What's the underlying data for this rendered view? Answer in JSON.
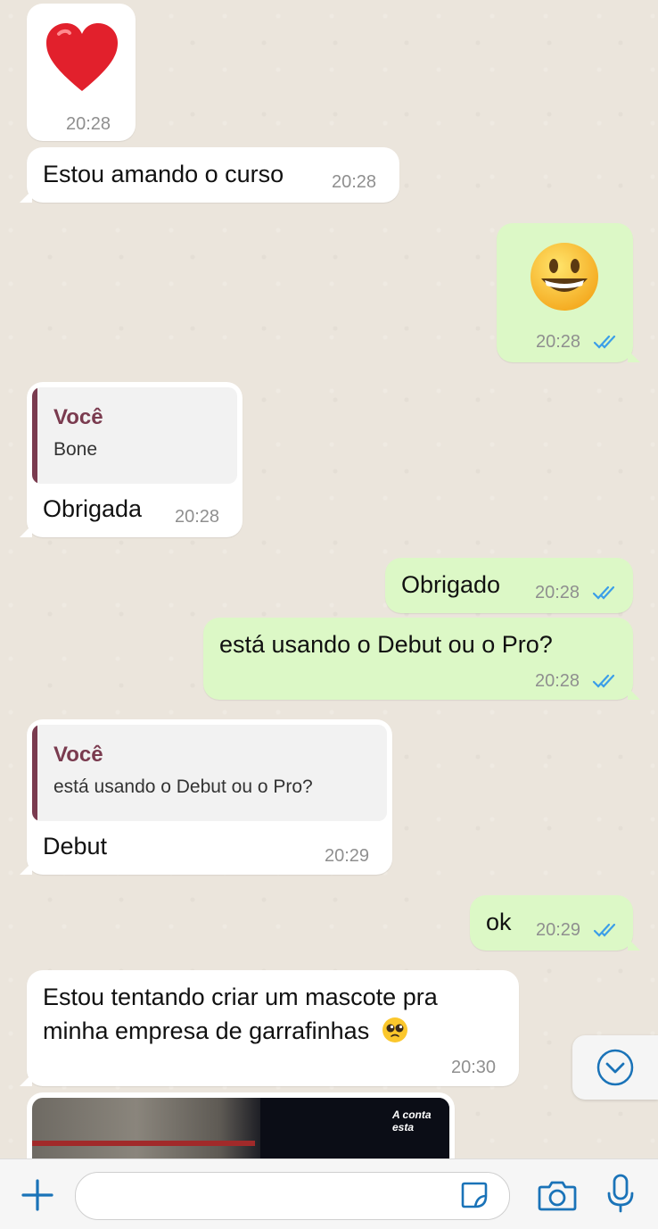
{
  "messages": [
    {
      "emoji_name": "red-heart",
      "time": "20:28"
    },
    {
      "text": "Estou amando o curso",
      "time": "20:28"
    },
    {
      "emoji_name": "grinning-face",
      "time": "20:28"
    },
    {
      "quote_author": "Você",
      "quote_text": "Bone",
      "text": "Obrigada",
      "time": "20:28"
    },
    {
      "text": "Obrigado",
      "time": "20:28"
    },
    {
      "text": "está usando o Debut ou o Pro?",
      "time": "20:28"
    },
    {
      "quote_author": "Você",
      "quote_text": "está usando o Debut ou o Pro?",
      "text": "Debut",
      "time": "20:29"
    },
    {
      "text": "ok",
      "time": "20:29"
    },
    {
      "text_line1": "Estou tentando criar um mascote pra",
      "text_line2": "minha empresa de garrafinhas",
      "emoji_name": "pleading-face",
      "time": "20:30"
    },
    {
      "image_caption": "A conta esta"
    }
  ],
  "composer": {
    "input_value": "",
    "icons": [
      "plus-icon",
      "sticker-icon",
      "camera-icon",
      "microphone-icon"
    ]
  },
  "colors": {
    "incoming_bubble": "#ffffff",
    "outgoing_bubble": "#dcf8c6",
    "read_checks": "#3b9ee8",
    "accent": "#1a73b8",
    "quote_author": "#7a3b4f"
  }
}
